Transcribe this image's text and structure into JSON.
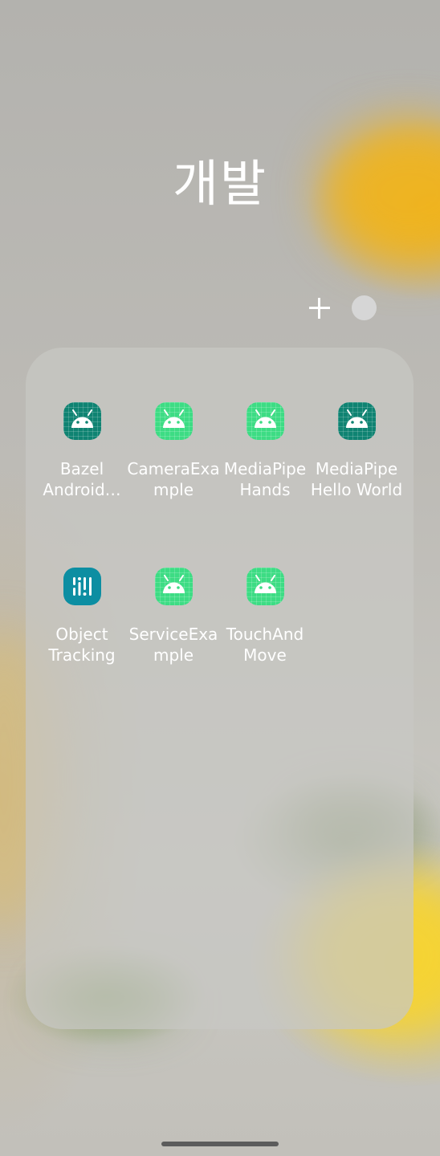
{
  "folder": {
    "title": "개발",
    "add_icon": "plus-icon",
    "color_dot_color": "#d6d6d6"
  },
  "apps": [
    {
      "label": "Bazel\nAndroid…",
      "icon": "android-icon",
      "icon_color": "#0f8372"
    },
    {
      "label": "CameraExa\nmple",
      "icon": "android-icon",
      "icon_color": "#3ddc84"
    },
    {
      "label": "MediaPipe\nHands",
      "icon": "android-icon",
      "icon_color": "#3ddc84"
    },
    {
      "label": "MediaPipe\nHello World",
      "icon": "android-icon",
      "icon_color": "#0f8372"
    },
    {
      "label": "Object\nTracking",
      "icon": "object-tracking-icon",
      "icon_color": "#0c8ea2"
    },
    {
      "label": "ServiceExa\nmple",
      "icon": "android-icon",
      "icon_color": "#3ddc84"
    },
    {
      "label": "TouchAnd\nMove",
      "icon": "android-icon",
      "icon_color": "#3ddc84"
    }
  ]
}
